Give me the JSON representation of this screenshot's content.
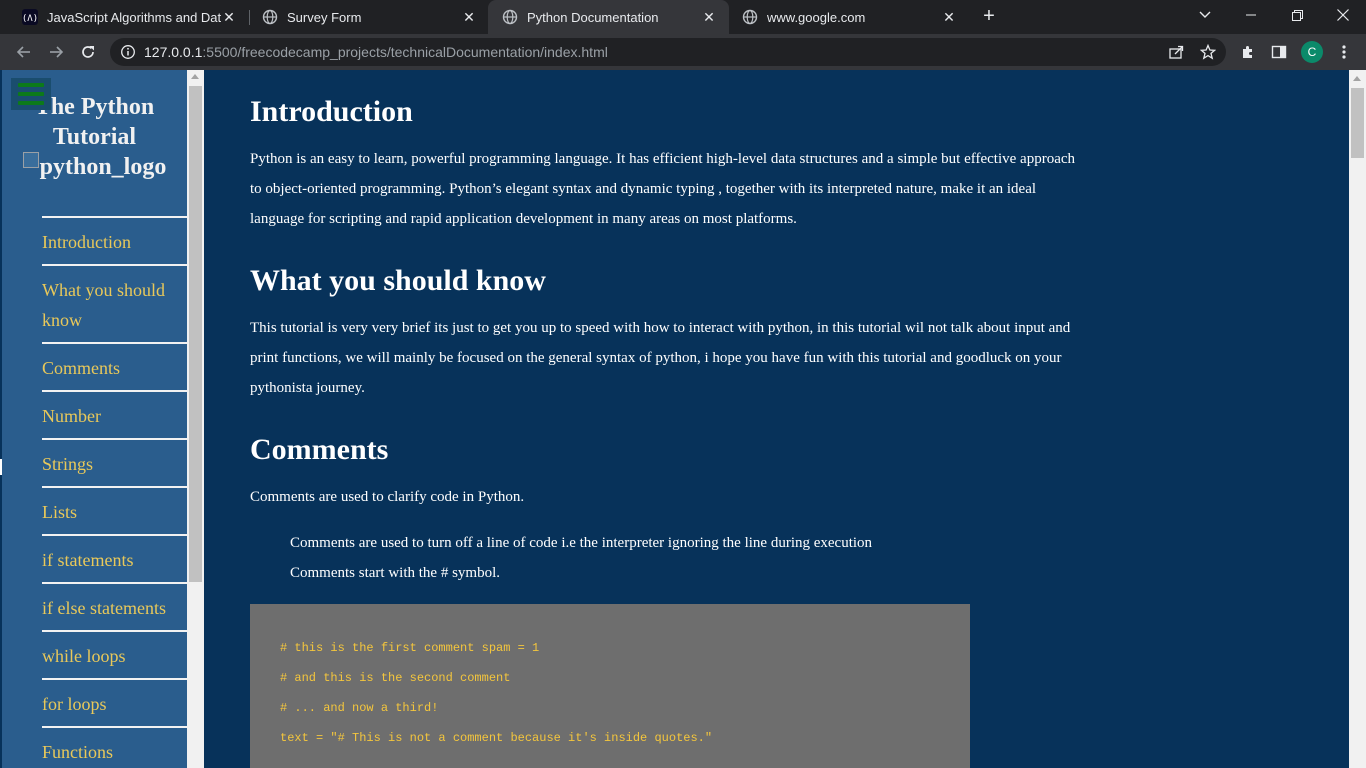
{
  "browser": {
    "tabs": [
      {
        "title": "JavaScript Algorithms and Data S",
        "icon": "freecodecamp-icon",
        "active": false
      },
      {
        "title": "Survey Form",
        "icon": "globe-icon",
        "active": false
      },
      {
        "title": "Python Documentation",
        "icon": "globe-icon",
        "active": true
      },
      {
        "title": "www.google.com",
        "icon": "globe-icon",
        "active": false
      }
    ],
    "url_host": "127.0.0.1",
    "url_path": ":5500/freecodecamp_projects/technicalDocumentation/index.html",
    "profile_initial": "C"
  },
  "sidebar": {
    "title": "The Python Tutorial",
    "logo_alt": "python_logo",
    "items": [
      "Introduction",
      "What you should know",
      "Comments",
      "Number",
      "Strings",
      "Lists",
      "if statements",
      "if else statements",
      "while loops",
      "for loops",
      "Functions"
    ]
  },
  "main": {
    "introduction": {
      "heading": "Introduction",
      "text": "Python is an easy to learn, powerful programming language. It has efficient high-level data structures and a simple but effective approach to object-oriented programming. Python’s elegant syntax and dynamic typing , together with its interpreted nature, make it an ideal language for scripting and rapid application development in many areas on most platforms."
    },
    "what_you_should_know": {
      "heading": "What you should know",
      "text": "This tutorial is very very brief its just to get you up to speed with how to interact with python, in this tutorial wil not talk about input and print functions, we will mainly be focused on the general syntax of python, i hope you have fun with this tutorial and goodluck on your pythonista journey."
    },
    "comments": {
      "heading": "Comments",
      "intro": "Comments are used to clarify code in Python.",
      "points": [
        "Comments are used to turn off a line of code i.e the interpreter ignoring the line during execution",
        "Comments start with the # symbol."
      ],
      "code": [
        "# this is the first comment spam = 1",
        "# and this is the second comment",
        "# ... and now a third!",
        "text = \"# This is not a comment because it's inside quotes.\""
      ]
    }
  },
  "colors": {
    "page_bg": "#07325a",
    "sidebar_bg": "#2a5d8d",
    "nav_link": "#e8c85a",
    "code_bg": "#6e6e6e",
    "code_text": "#f4c63d"
  }
}
